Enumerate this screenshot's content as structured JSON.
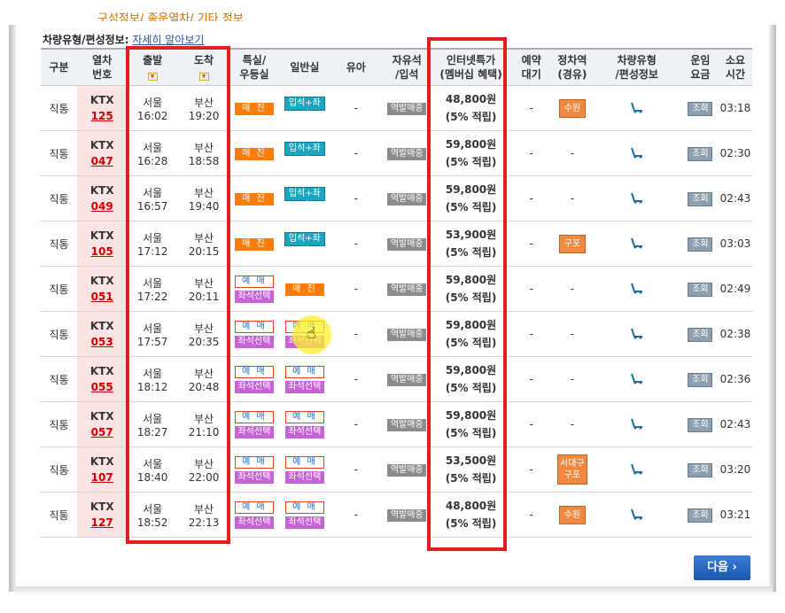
{
  "top_cut_text": "구성정보/ 종운열차/ 기타 정보",
  "info": {
    "label": "차량유형/편성정보:",
    "link": "자세히 알아보기"
  },
  "headers": {
    "type": "구분",
    "train": [
      "열차",
      "번호"
    ],
    "dep": "출발",
    "arr": "도착",
    "special": [
      "특실/",
      "우등실"
    ],
    "general": "일반실",
    "infant": "유아",
    "free": [
      "자유석",
      "/입석"
    ],
    "internet": [
      "인터넷특가",
      "(멤버십 혜택)"
    ],
    "waitlist": [
      "예약",
      "대기"
    ],
    "stops": [
      "정차역",
      "(경유)"
    ],
    "vehicle": [
      "차량유형",
      "/편성정보"
    ],
    "fare": [
      "운임",
      "요금"
    ],
    "duration": [
      "소요",
      "시간"
    ]
  },
  "labels": {
    "soldout": "매 진",
    "standing": "입석+좌석",
    "reserve": "예 매",
    "seat_select": "좌석선택",
    "free_standing": "역발매중",
    "view": "조회",
    "dash": "-",
    "sort_arrow": "▼",
    "next": "다음 ›"
  },
  "rows": [
    {
      "kind": "직통",
      "train": "KTX",
      "num": "125",
      "from": "서울",
      "dep": "16:02",
      "to": "부산",
      "arr": "19:20",
      "special": "soldout",
      "general": "standing",
      "price": "48,800원",
      "benefit": "(5% 적립)",
      "stop": "수원",
      "duration": "03:18"
    },
    {
      "kind": "직통",
      "train": "KTX",
      "num": "047",
      "from": "서울",
      "dep": "16:28",
      "to": "부산",
      "arr": "18:58",
      "special": "soldout",
      "general": "standing",
      "price": "59,800원",
      "benefit": "(5% 적립)",
      "stop": "-",
      "duration": "02:30"
    },
    {
      "kind": "직통",
      "train": "KTX",
      "num": "049",
      "from": "서울",
      "dep": "16:57",
      "to": "부산",
      "arr": "19:40",
      "special": "soldout",
      "general": "standing",
      "price": "59,800원",
      "benefit": "(5% 적립)",
      "stop": "-",
      "duration": "02:43"
    },
    {
      "kind": "직통",
      "train": "KTX",
      "num": "105",
      "from": "서울",
      "dep": "17:12",
      "to": "부산",
      "arr": "20:15",
      "special": "soldout",
      "general": "standing",
      "price": "53,900원",
      "benefit": "(5% 적립)",
      "stop": "구포",
      "duration": "03:03"
    },
    {
      "kind": "직통",
      "train": "KTX",
      "num": "051",
      "from": "서울",
      "dep": "17:22",
      "to": "부산",
      "arr": "20:11",
      "special": "reserve",
      "general": "soldout",
      "price": "59,800원",
      "benefit": "(5% 적립)",
      "stop": "-",
      "duration": "02:49"
    },
    {
      "kind": "직통",
      "train": "KTX",
      "num": "053",
      "from": "서울",
      "dep": "17:57",
      "to": "부산",
      "arr": "20:35",
      "special": "reserve",
      "general": "reserve",
      "price": "59,800원",
      "benefit": "(5% 적립)",
      "stop": "-",
      "duration": "02:38"
    },
    {
      "kind": "직통",
      "train": "KTX",
      "num": "055",
      "from": "서울",
      "dep": "18:12",
      "to": "부산",
      "arr": "20:48",
      "special": "reserve",
      "general": "reserve",
      "price": "59,800원",
      "benefit": "(5% 적립)",
      "stop": "-",
      "duration": "02:36"
    },
    {
      "kind": "직통",
      "train": "KTX",
      "num": "057",
      "from": "서울",
      "dep": "18:27",
      "to": "부산",
      "arr": "21:10",
      "special": "reserve",
      "general": "reserve",
      "price": "59,800원",
      "benefit": "(5% 적립)",
      "stop": "-",
      "duration": "02:43"
    },
    {
      "kind": "직통",
      "train": "KTX",
      "num": "107",
      "from": "서울",
      "dep": "18:40",
      "to": "부산",
      "arr": "22:00",
      "special": "reserve",
      "general": "reserve",
      "price": "53,500원",
      "benefit": "(5% 적립)",
      "stop": "서대구\n구포",
      "duration": "03:20"
    },
    {
      "kind": "직통",
      "train": "KTX",
      "num": "127",
      "from": "서울",
      "dep": "18:52",
      "to": "부산",
      "arr": "22:13",
      "special": "reserve",
      "general": "reserve",
      "price": "48,800원",
      "benefit": "(5% 적립)",
      "stop": "수원",
      "duration": "03:21"
    }
  ]
}
